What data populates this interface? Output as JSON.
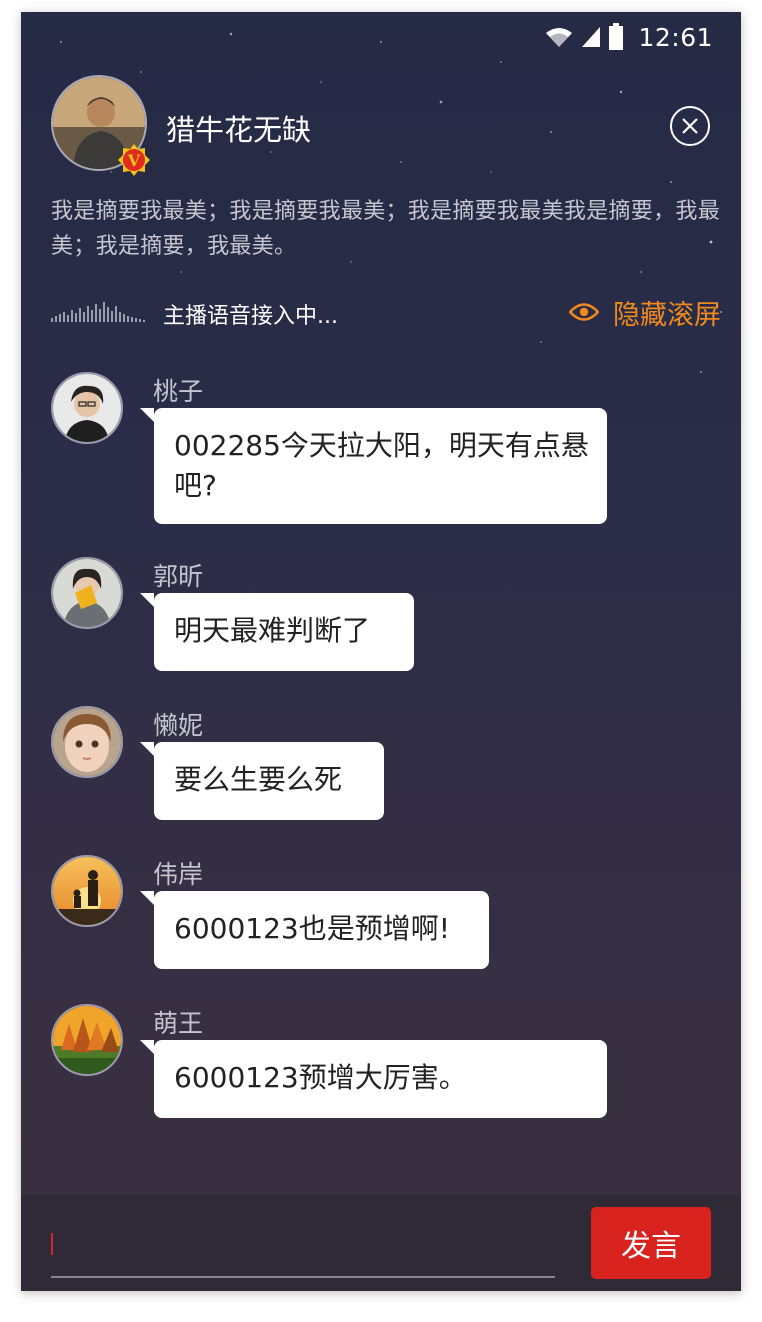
{
  "status_bar": {
    "time": "12:61"
  },
  "host": {
    "name": "猎牛花无缺",
    "badge": "V",
    "summary": "我是摘要我最美；我是摘要我最美；我是摘要我最美我是摘要，我最美；我是摘要，我最美。"
  },
  "voice": {
    "status": "主播语音接入中..."
  },
  "controls": {
    "hide_scroll": "隐藏滚屏",
    "send": "发言"
  },
  "input": {
    "placeholder": ""
  },
  "messages": [
    {
      "user": "桃子",
      "text": "002285今天拉大阳，明天有点悬吧?"
    },
    {
      "user": "郭昕",
      "text": "明天最难判断了"
    },
    {
      "user": "懒妮",
      "text": "要么生要么死"
    },
    {
      "user": "伟岸",
      "text": "6000123也是预增啊!"
    },
    {
      "user": "萌王",
      "text": "6000123预增大厉害。"
    }
  ],
  "colors": {
    "accent_orange": "#f08a1d",
    "send_red": "#d8221d",
    "bg_top": "#252a45",
    "bg_bottom": "#3a2f3e"
  }
}
